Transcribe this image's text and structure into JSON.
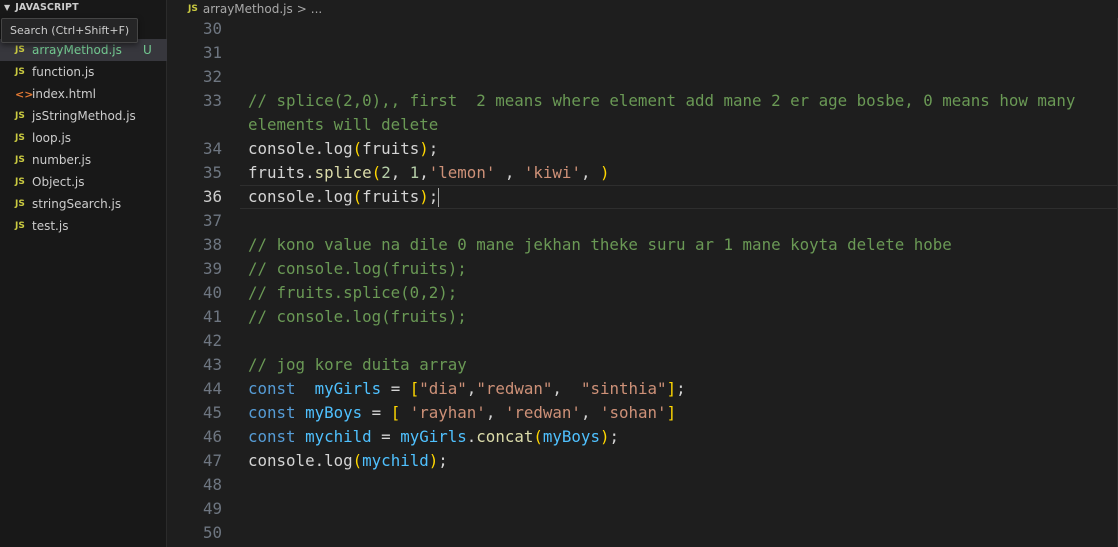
{
  "sidebar": {
    "section_title": "JAVASCRIPT",
    "tooltip": "Search (Ctrl+Shift+F)",
    "files": [
      {
        "name": "arrayMethod.js",
        "icon": "js-file-icon",
        "badge": "U",
        "active": true
      },
      {
        "name": "function.js",
        "icon": "js-file-icon"
      },
      {
        "name": "index.html",
        "icon": "html-file-icon"
      },
      {
        "name": "jsStringMethod.js",
        "icon": "js-file-icon"
      },
      {
        "name": "loop.js",
        "icon": "js-file-icon"
      },
      {
        "name": "number.js",
        "icon": "js-file-icon"
      },
      {
        "name": "Object.js",
        "icon": "js-file-icon"
      },
      {
        "name": "stringSearch.js",
        "icon": "js-file-icon"
      },
      {
        "name": "test.js",
        "icon": "js-file-icon"
      }
    ],
    "js_icon_text": "JS",
    "html_icon_text": "<>"
  },
  "breadcrumb": {
    "icon_text": "JS",
    "file": "arrayMethod.js",
    "separator": ">",
    "rest": "..."
  },
  "editor": {
    "current_line": 36,
    "lines": [
      {
        "num": "30",
        "text": ""
      },
      {
        "num": "31",
        "text": ""
      },
      {
        "num": "32",
        "text": ""
      },
      {
        "num": "33",
        "text": "// splice(2,0),, first  2 means where element add mane 2 er age bosbe, 0 means how many",
        "wrap": "elements will delete"
      },
      {
        "num": "34",
        "text": "console.log(fruits);"
      },
      {
        "num": "35",
        "text": "fruits.splice(2, 1,'lemon' , 'kiwi', )"
      },
      {
        "num": "36",
        "text": "console.log(fruits);"
      },
      {
        "num": "37",
        "text": ""
      },
      {
        "num": "38",
        "text": "// kono value na dile 0 mane jekhan theke suru ar 1 mane koyta delete hobe"
      },
      {
        "num": "39",
        "text": "// console.log(fruits);"
      },
      {
        "num": "40",
        "text": "// fruits.splice(0,2);"
      },
      {
        "num": "41",
        "text": "// console.log(fruits);"
      },
      {
        "num": "42",
        "text": ""
      },
      {
        "num": "43",
        "text": "// jog kore duita array"
      },
      {
        "num": "44",
        "text": "const  myGirls = [\"dia\",\"redwan\",  \"sinthia\"];"
      },
      {
        "num": "45",
        "text": "const myBoys = [ 'rayhan', 'redwan', 'sohan']"
      },
      {
        "num": "46",
        "text": "const mychild = myGirls.concat(myBoys);"
      },
      {
        "num": "47",
        "text": "console.log(mychild);"
      },
      {
        "num": "48",
        "text": ""
      },
      {
        "num": "49",
        "text": ""
      },
      {
        "num": "50",
        "text": ""
      }
    ]
  },
  "colors": {
    "comment": "#6a9955",
    "keyword": "#569cd6",
    "string": "#ce9178",
    "number": "#b5cea8",
    "untracked": "#73c991"
  }
}
